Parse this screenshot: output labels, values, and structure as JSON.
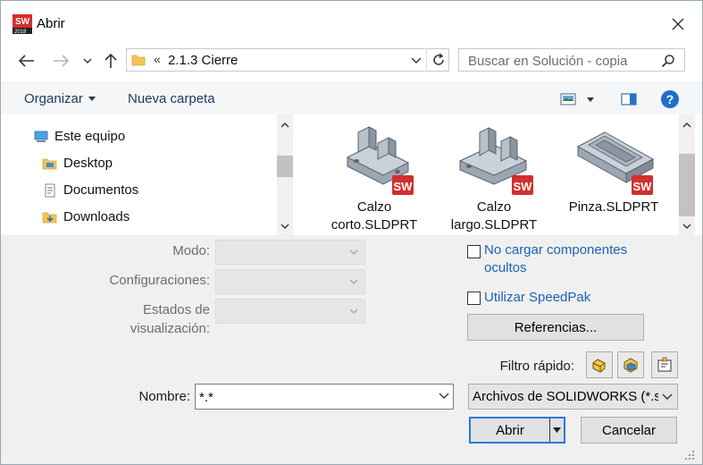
{
  "window": {
    "title": "Abrir"
  },
  "app_icon": {
    "name": "solidworks-2018-icon",
    "year": "2018"
  },
  "navigation": {
    "address_root_chevron": "«",
    "address_path": "2.1.3 Cierre",
    "search_placeholder": "Buscar en Solución - copia"
  },
  "toolbar": {
    "organize_label": "Organizar",
    "new_folder_label": "Nueva carpeta"
  },
  "nav_pane": {
    "items": [
      {
        "label": "Este equipo",
        "icon": "computer-icon"
      },
      {
        "label": "Desktop",
        "icon": "desktop-folder-icon"
      },
      {
        "label": "Documentos",
        "icon": "documents-folder-icon"
      },
      {
        "label": "Downloads",
        "icon": "downloads-folder-icon"
      }
    ]
  },
  "files": [
    {
      "name_line1": "Calzo",
      "name_line2": "corto.SLDPRT"
    },
    {
      "name_line1": "Calzo",
      "name_line2": "largo.SLDPRT"
    },
    {
      "name_line1": "Pinza.SLDPRT",
      "name_line2": ""
    }
  ],
  "options": {
    "mode_label": "Modo:",
    "config_label": "Configuraciones:",
    "display_label_line1": "Estados de",
    "display_label_line2": "visualización:",
    "no_load_label_line1": "No cargar componentes",
    "no_load_label_line2": "ocultos",
    "speedpak_label": "Utilizar SpeedPak",
    "references_label": "Referencias...",
    "quick_filter_label": "Filtro rápido:"
  },
  "bottom": {
    "name_label": "Nombre:",
    "name_value": "*.*",
    "file_type_value": "Archivos de SOLIDWORKS (*.slc",
    "open_label": "Abrir",
    "cancel_label": "Cancelar"
  },
  "colors": {
    "accent": "#2b79d7",
    "link": "#1b62b5",
    "solidworks_red": "#d32f2f"
  }
}
